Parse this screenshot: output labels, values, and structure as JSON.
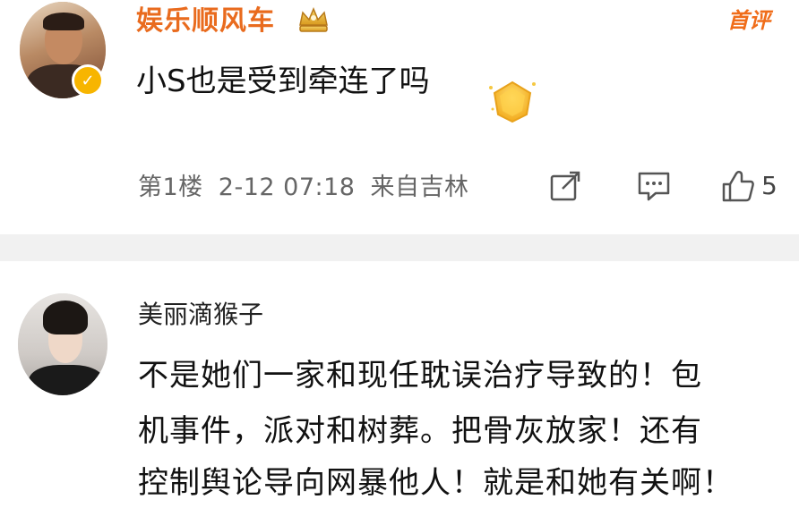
{
  "comment1": {
    "username": "娱乐顺风车",
    "tag": "首评",
    "text": "小S也是受到牵连了吗",
    "floor": "第1楼",
    "datetime": "2-12 07:18",
    "location": "来自吉林",
    "like_count": "5"
  },
  "comment2": {
    "username": "美丽滴猴子",
    "lines": [
      "不是她们一家和现任耽误治疗导致的！包",
      "机事件，派对和树葬。把骨灰放家！还有",
      "控制舆论导向网暴他人！就是和她有关啊！"
    ]
  },
  "colors": {
    "username_orange": "#e96b1e",
    "tag_orange": "#f06d1a",
    "verify_gold": "#f7b500",
    "meta_gray": "#666666",
    "divider": "#f1f1f1"
  },
  "icons": [
    "crown-badge-icon",
    "gold-gem-icon",
    "share-icon",
    "comment-icon",
    "like-icon",
    "verified-icon"
  ]
}
